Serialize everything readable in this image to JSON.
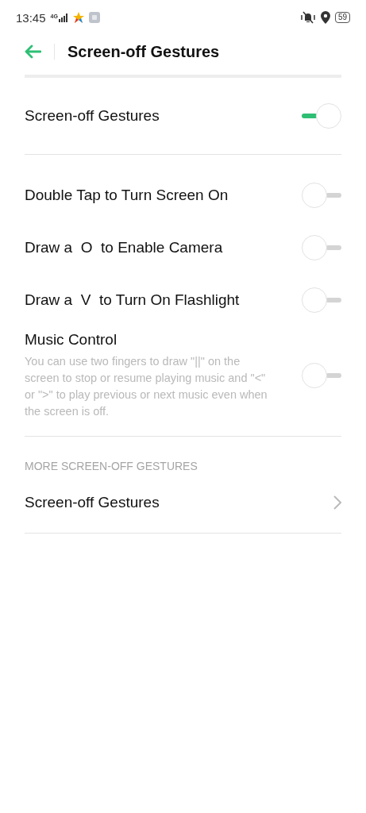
{
  "status_bar": {
    "time": "13:45",
    "network": "4G",
    "battery": "59"
  },
  "header": {
    "title": "Screen-off Gestures"
  },
  "master": {
    "label": "Screen-off Gestures",
    "on": true
  },
  "gestures": [
    {
      "label": "Double Tap to Turn Screen On",
      "on": false
    },
    {
      "label": "Draw a  O  to Enable Camera",
      "on": false
    },
    {
      "label": "Draw a  V  to Turn On Flashlight",
      "on": false
    },
    {
      "label": "Music Control",
      "description": "You can use two fingers to draw \"||\" on the screen to stop or resume playing music and \"<\" or \">\" to play previous or next music even when the screen is off.",
      "on": false
    }
  ],
  "more": {
    "heading": "MORE SCREEN-OFF GESTURES",
    "items": [
      {
        "label": "Screen-off Gestures"
      }
    ]
  }
}
